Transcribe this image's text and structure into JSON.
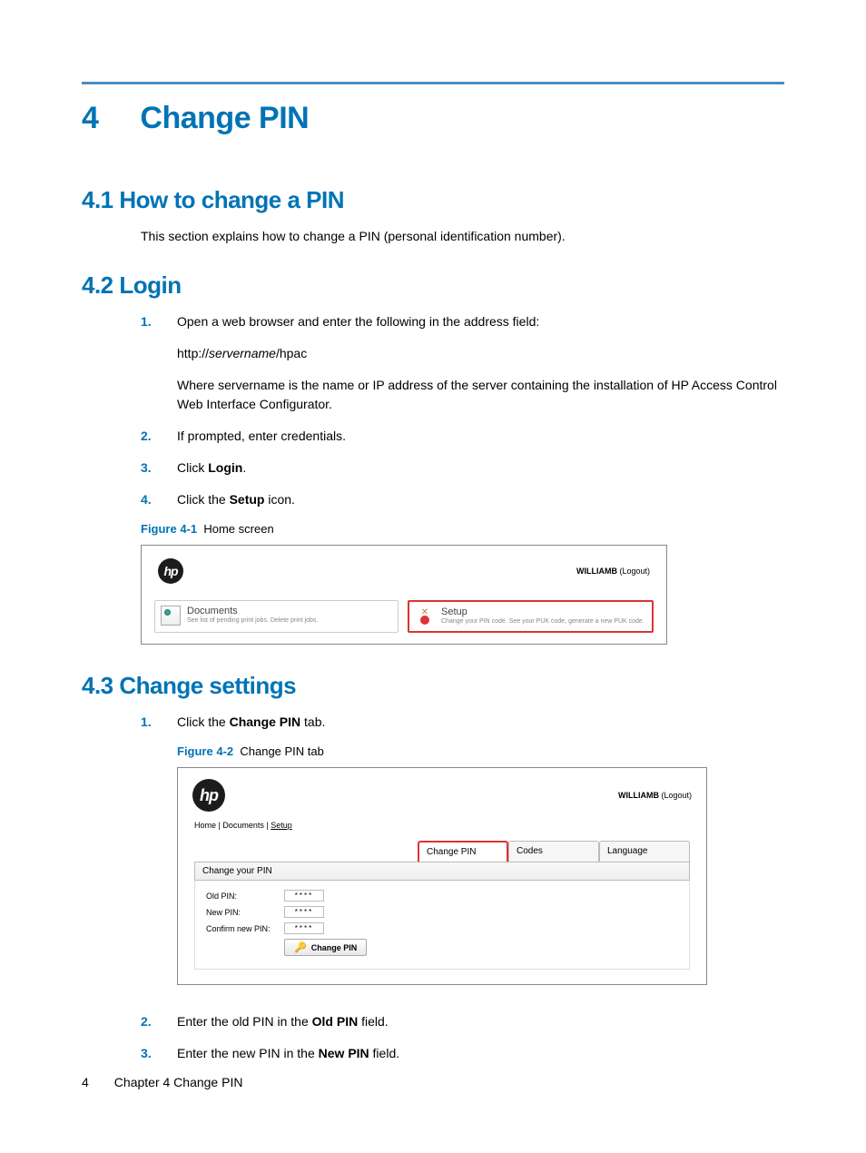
{
  "chapter": {
    "num": "4",
    "title": "Change PIN"
  },
  "section_41": {
    "heading": "4.1 How to change a PIN",
    "body": "This section explains how to change a PIN (personal identification number)."
  },
  "section_42": {
    "heading": "4.2 Login",
    "steps": [
      {
        "num": "1.",
        "text": "Open a web browser and enter the following in the address field:"
      },
      {
        "num": "2.",
        "text": "If prompted, enter credentials."
      },
      {
        "num": "3.",
        "text_prefix": "Click ",
        "bold": "Login",
        "text_suffix": "."
      },
      {
        "num": "4.",
        "text_prefix": "Click the ",
        "bold": "Setup",
        "text_suffix": " icon."
      }
    ],
    "url_line": {
      "prefix": "http://",
      "server": "servername",
      "suffix": "/hpac"
    },
    "where": "Where servername is the name or IP address of the server containing the installation of HP Access Control Web Interface Configurator."
  },
  "figure_41": {
    "label": "Figure 4-1",
    "title": "Home screen",
    "username": "WILLIAMB",
    "logout": "(Logout)",
    "card_docs": {
      "title": "Documents",
      "sub": "See list of pending print jobs. Delete print jobs."
    },
    "card_setup": {
      "title": "Setup",
      "sub": "Change your PIN code. See your PUK code, generate a new PUK code."
    }
  },
  "section_43": {
    "heading": "4.3 Change settings",
    "step1": {
      "num": "1.",
      "prefix": "Click the ",
      "bold": "Change PIN",
      "suffix": " tab."
    },
    "step2": {
      "num": "2.",
      "prefix": "Enter the old PIN in the ",
      "bold": "Old PIN",
      "suffix": " field."
    },
    "step3": {
      "num": "3.",
      "prefix": "Enter the new PIN in the ",
      "bold": "New PIN",
      "suffix": " field."
    }
  },
  "figure_42": {
    "label": "Figure 4-2",
    "title": "Change PIN tab",
    "username": "WILLIAMB",
    "logout": "(Logout)",
    "crumbs": {
      "home": "Home",
      "docs": "Documents",
      "setup": "Setup"
    },
    "tabs": {
      "changepin": "Change PIN",
      "codes": "Codes",
      "language": "Language"
    },
    "panel_title": "Change your PIN",
    "form": {
      "old": "Old PIN:",
      "new": "New PIN:",
      "confirm": "Confirm new PIN:",
      "mask": "****",
      "button": "Change PIN"
    }
  },
  "footer": {
    "page": "4",
    "chapter": "Chapter 4   Change PIN"
  }
}
